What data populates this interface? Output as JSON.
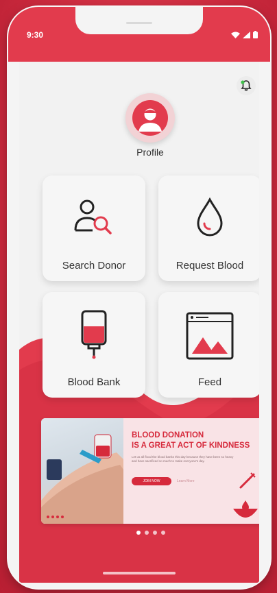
{
  "status_bar": {
    "time": "9:30",
    "icons": [
      "wifi-icon",
      "signal-icon",
      "battery-icon"
    ]
  },
  "header": {
    "icon": "notification-bell-icon"
  },
  "profile": {
    "label": "Profile",
    "icon": "user-avatar-icon"
  },
  "tiles": [
    {
      "label": "Search Donor",
      "icon": "search-donor-icon"
    },
    {
      "label": "Request Blood",
      "icon": "blood-drop-icon"
    },
    {
      "label": "Blood Bank",
      "icon": "blood-bag-icon"
    },
    {
      "label": "Feed",
      "icon": "image-feed-icon"
    }
  ],
  "banner": {
    "title_line1": "Blood Donation",
    "title_line2": "Is A Great Act Of Kindness",
    "body": "Let us all flood the blood banks this day because they have been so heavy and have sacrificed so much to make everyone's day.",
    "cta": "JOIN NOW",
    "secondary": "Learn More"
  },
  "pager": {
    "count": 4,
    "active_index": 0
  },
  "colors": {
    "brand_red": "#e23b4d",
    "accent_red": "#d62a3c",
    "background": "#f2f2f2"
  }
}
